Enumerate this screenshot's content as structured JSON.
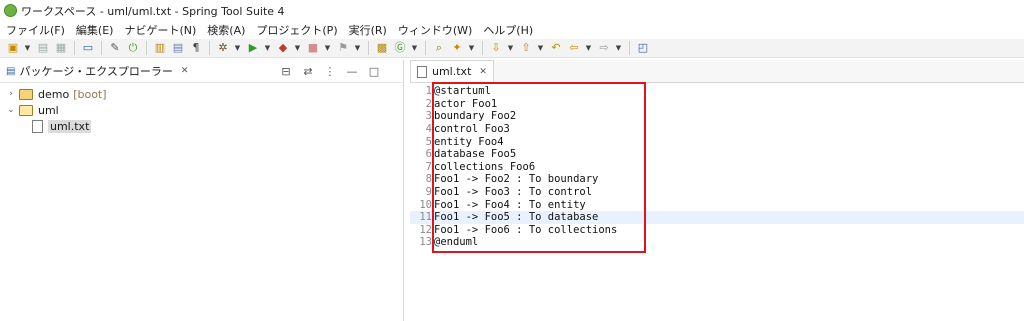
{
  "window": {
    "title": "ワークスペース - uml/uml.txt - Spring Tool Suite 4"
  },
  "menu": [
    "ファイル(F)",
    "編集(E)",
    "ナビゲート(N)",
    "検索(A)",
    "プロジェクト(P)",
    "実行(R)",
    "ウィンドウ(W)",
    "ヘルプ(H)"
  ],
  "toolbar": {
    "icons": [
      "new-icon",
      "save-icon",
      "save-all-icon",
      "print-icon",
      "pin-icon",
      "spring-boot-icon",
      "open-type-icon",
      "open-task-icon",
      "pilcrow-icon",
      "debug-icon",
      "run-icon",
      "coverage-icon",
      "stop-icon",
      "external-tools-icon",
      "new-java-project-icon",
      "new-spring-icon",
      "search-icon",
      "compass-icon",
      "next-annotation-icon",
      "prev-annotation-icon",
      "last-edit-icon",
      "back-icon",
      "forward-icon",
      "open-perspective-icon"
    ]
  },
  "left_panel": {
    "tab_label": "パッケージ・エクスプローラー",
    "tree": [
      {
        "label": "demo",
        "badge": "[boot]",
        "expanded": false,
        "type": "project"
      },
      {
        "label": "uml",
        "badge": "",
        "expanded": true,
        "type": "project"
      },
      {
        "label": "uml.txt",
        "badge": "",
        "type": "file",
        "selected": true
      }
    ]
  },
  "editor": {
    "tab_label": "uml.txt",
    "lines": [
      {
        "n": "1",
        "text": "@startuml"
      },
      {
        "n": "2",
        "text": "actor Foo1"
      },
      {
        "n": "3",
        "text": "boundary Foo2"
      },
      {
        "n": "4",
        "text": "control Foo3"
      },
      {
        "n": "5",
        "text": "entity Foo4"
      },
      {
        "n": "6",
        "text": "database Foo5"
      },
      {
        "n": "7",
        "text": "collections Foo6"
      },
      {
        "n": "8",
        "text": "Foo1 -> Foo2 : To boundary"
      },
      {
        "n": "9",
        "text": "Foo1 -> Foo3 : To control"
      },
      {
        "n": "10",
        "text": "Foo1 -> Foo4 : To entity"
      },
      {
        "n": "11",
        "text": "Foo1 -> Foo5 : To database"
      },
      {
        "n": "12",
        "text": "Foo1 -> Foo6 : To collections"
      },
      {
        "n": "13",
        "text": "@enduml"
      }
    ],
    "current_line": 11
  },
  "colors": {
    "highlight_border": "#e0141e",
    "current_line": "#e8f2fe"
  }
}
